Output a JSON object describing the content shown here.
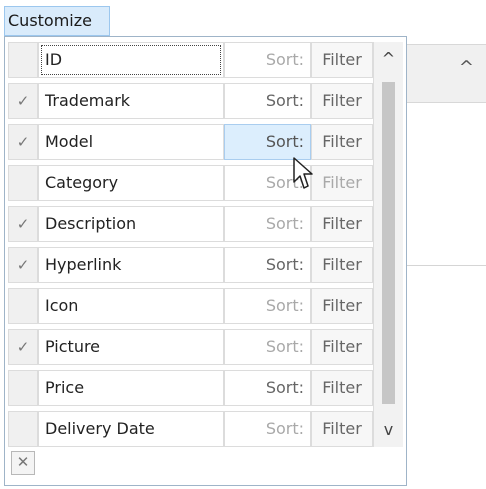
{
  "customize_tab": {
    "label": "Customize"
  },
  "fields": [
    {
      "name": "ID",
      "checked": false,
      "sort": "Sort:",
      "filter": "Filter"
    },
    {
      "name": "Trademark",
      "checked": true,
      "sort": "Sort:",
      "filter": "Filter"
    },
    {
      "name": "Model",
      "checked": true,
      "sort": "Sort:",
      "filter": "Filter"
    },
    {
      "name": "Category",
      "checked": false,
      "sort": "Sort:",
      "filter": "Filter"
    },
    {
      "name": "Description",
      "checked": true,
      "sort": "Sort:",
      "filter": "Filter"
    },
    {
      "name": "Hyperlink",
      "checked": true,
      "sort": "Sort:",
      "filter": "Filter"
    },
    {
      "name": "Icon",
      "checked": false,
      "sort": "Sort:",
      "filter": "Filter"
    },
    {
      "name": "Picture",
      "checked": true,
      "sort": "Sort:",
      "filter": "Filter"
    },
    {
      "name": "Price",
      "checked": false,
      "sort": "Sort:",
      "filter": "Filter"
    },
    {
      "name": "Delivery Date",
      "checked": false,
      "sort": "Sort:",
      "filter": "Filter"
    }
  ],
  "icons": {
    "check": "✓",
    "scroll_up": "^",
    "scroll_down": "v",
    "close": "✕"
  }
}
